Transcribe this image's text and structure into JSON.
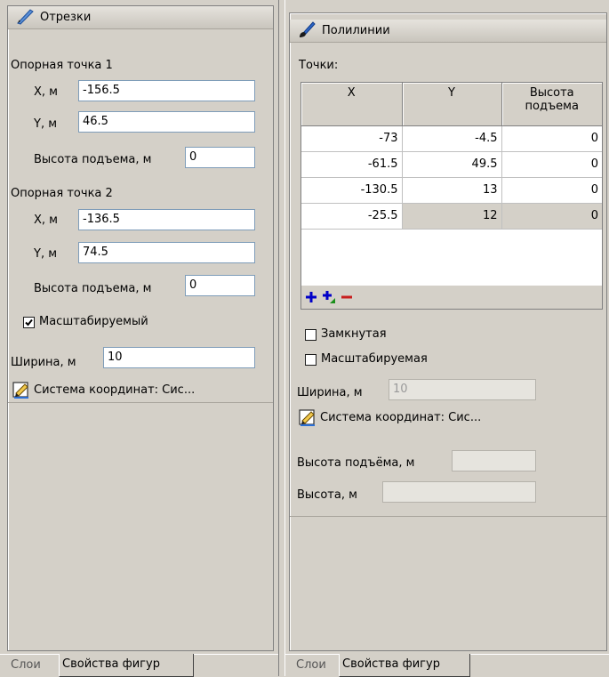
{
  "left_panel": {
    "title": "Отрезки",
    "title_icon": "pencil-icon",
    "point1": {
      "heading": "Опорная точка 1",
      "x_label": "X, м",
      "x_value": "-156.5",
      "y_label": "Y, м",
      "y_value": "46.5",
      "h_label": "Высота подъема, м",
      "h_value": "0"
    },
    "point2": {
      "heading": "Опорная точка 2",
      "x_label": "X, м",
      "x_value": "-136.5",
      "y_label": "Y, м",
      "y_value": "74.5",
      "h_label": "Высота подъема, м",
      "h_value": "0"
    },
    "scalable_label": "Масштабируемый",
    "scalable_checked": true,
    "width_label": "Ширина, м",
    "width_value": "10",
    "coord_system_label": "Система координат: Сис...",
    "coord_icon": "edit-icon"
  },
  "right_panel": {
    "title": "Полилинии",
    "title_icon": "brush-icon",
    "points_label": "Точки:",
    "columns": [
      "X",
      "Y",
      "Высота подъема"
    ],
    "rows": [
      [
        "-73",
        "-4.5",
        "0"
      ],
      [
        "-61.5",
        "49.5",
        "0"
      ],
      [
        "-130.5",
        "13",
        "0"
      ],
      [
        "-25.5",
        "12",
        "0"
      ]
    ],
    "selected_row": 3,
    "closed_label": "Замкнутая",
    "closed_checked": false,
    "scalable_label": "Масштабируемая",
    "scalable_checked": false,
    "width_label": "Ширина, м",
    "width_value": "10",
    "coord_system_label": "Система координат: Сис...",
    "lift_label": "Высота подъёма, м",
    "lift_value": "",
    "height_label": "Высота, м",
    "height_value": ""
  },
  "tabs_left": [
    {
      "label": "Слои",
      "active": false
    },
    {
      "label": "Свойства фигур",
      "active": true
    }
  ],
  "tabs_right": [
    {
      "label": "Слои",
      "active": false
    },
    {
      "label": "Свойства фигур",
      "active": true
    }
  ],
  "colors": {
    "panel_bg": "#d4d0c8",
    "field_border": "#7f9db9",
    "add_icon": "#0000c8",
    "add_green": "#1a8f1a",
    "remove_icon": "#c81e1e"
  }
}
